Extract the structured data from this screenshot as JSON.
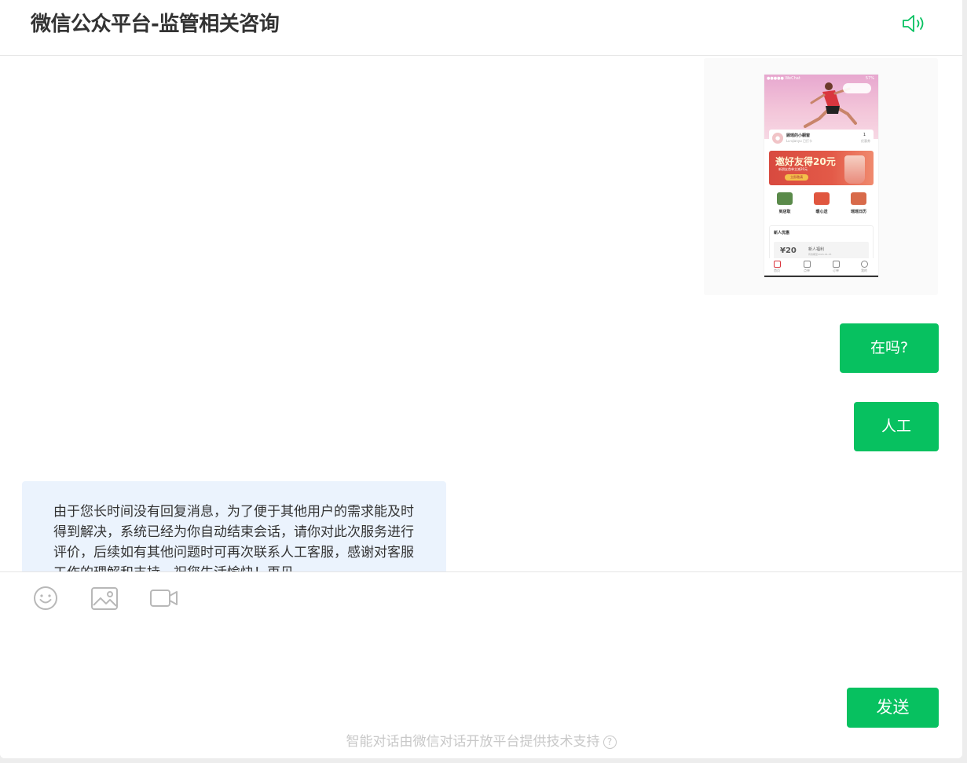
{
  "header": {
    "title": "微信公众平台-监管相关咨询",
    "speaker_icon": "speaker-icon"
  },
  "screenshot": {
    "status_left": "●●●●● WeChat",
    "status_right": "57%",
    "user_name": "顾瑶的小橱窗",
    "user_sub": "Lu-qianyu 已打卡",
    "count": "1",
    "count_label": "优惠券",
    "banner_title": "邀好友得20元",
    "banner_sub": "新朋友首单立减20元",
    "banner_button": "立即邀请",
    "icons": [
      "到店取",
      "暖心送",
      "瑶瑶日历"
    ],
    "new_title": "新人优惠",
    "coupon_value": "¥20",
    "coupon_name": "新人福利",
    "coupon_date": "有效期至2024-01-15",
    "tabs": [
      "首页",
      "点单",
      "订单",
      "我的"
    ]
  },
  "messages": {
    "m1": "在吗?",
    "m2": "人工",
    "m3": "由于您长时间没有回复消息，为了便于其他用户的需求能及时得到解决，系统已经为你自动结束会话，请你对此次服务进行评价，后续如有其他问题时可再次联系人工客服，感谢对客服工作的理解和支持，祝您生活愉快！再见"
  },
  "composer": {
    "tools": [
      "emoji-icon",
      "image-icon",
      "video-icon"
    ],
    "input_value": "",
    "send_label": "发送"
  },
  "footer": {
    "text": "智能对话由微信对话开放平台提供技术支持",
    "help_glyph": "?"
  },
  "colors": {
    "accent": "#07c160",
    "received_bubble": "#ebf3fd"
  }
}
